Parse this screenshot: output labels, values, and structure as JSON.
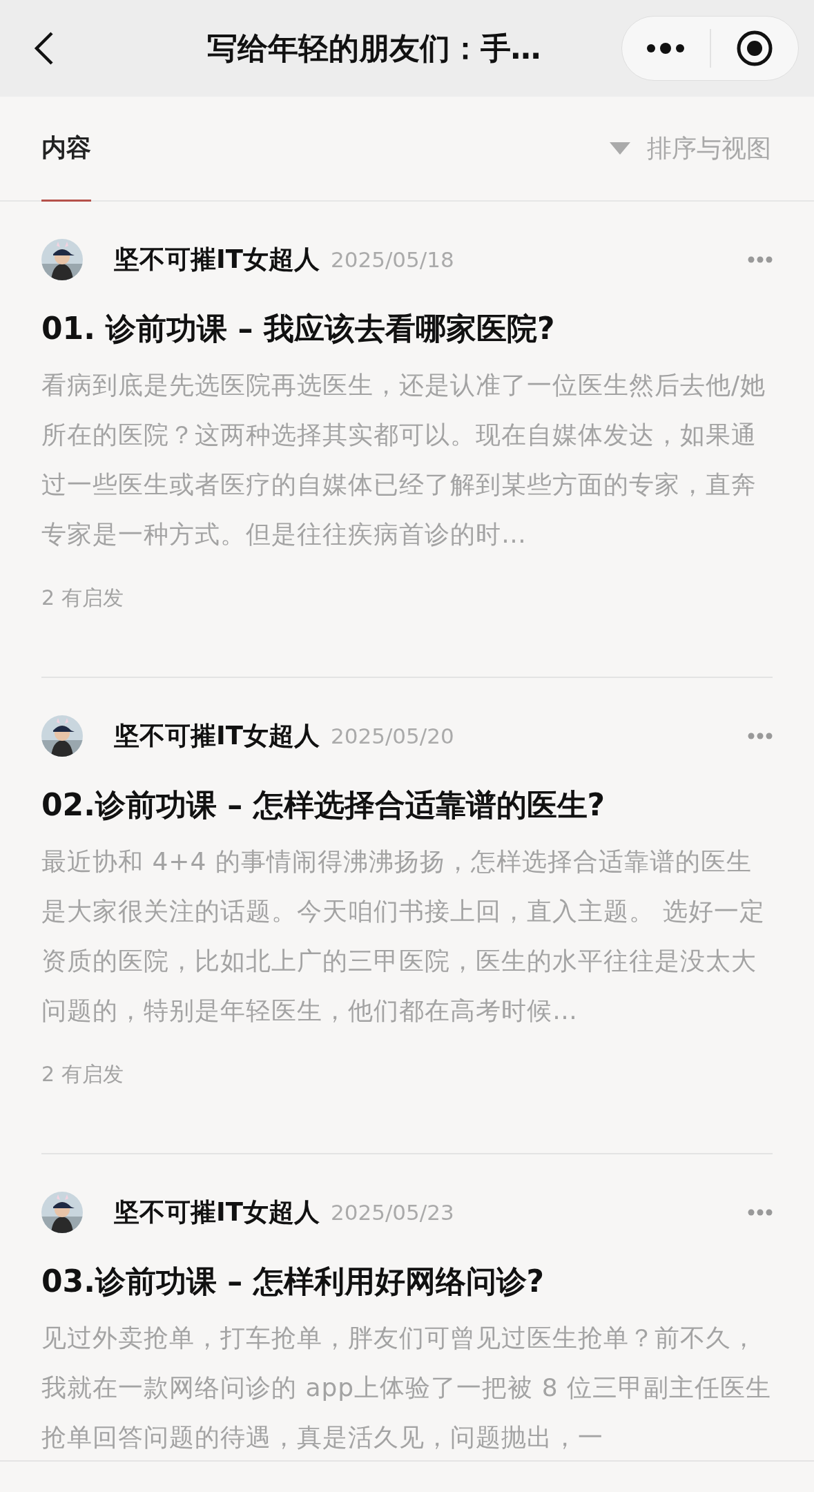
{
  "nav": {
    "title": "写给年轻的朋友们：手…"
  },
  "tabs": [
    {
      "label": "内容",
      "selected": true
    }
  ],
  "sort": {
    "label": "排序与视图"
  },
  "articles": [
    {
      "author": "坚不可摧IT女超人",
      "date": "2025/05/18",
      "title": "01. 诊前功课 – 我应该去看哪家医院?",
      "excerpt": "看病到底是先选医院再选医生，还是认准了一位医生然后去他/她所在的医院？这两种选择其实都可以。现在自媒体发达，如果通过一些医生或者医疗的自媒体已经了解到某些方面的专家，直奔专家是一种方式。但是往往疾病首诊的时…",
      "reactions": "2 有启发"
    },
    {
      "author": "坚不可摧IT女超人",
      "date": "2025/05/20",
      "title": "02.诊前功课 – 怎样选择合适靠谱的医生?",
      "excerpt": "最近协和 4+4 的事情闹得沸沸扬扬，怎样选择合适靠谱的医生是大家很关注的话题。今天咱们书接上回，直入主题。 选好一定资质的医院，比如北上广的三甲医院，医生的水平往往是没太大问题的，特别是年轻医生，他们都在高考时候…",
      "reactions": "2 有启发"
    },
    {
      "author": "坚不可摧IT女超人",
      "date": "2025/05/23",
      "title": "03.诊前功课 – 怎样利用好网络问诊?",
      "excerpt": "见过外卖抢单，打车抢单，胖友们可曾见过医生抢单？前不久，我就在一款网络问诊的 app上体验了一把被 8 位三甲副主任医生抢单回答问题的待遇，真是活久见，问题抛出，一"
    }
  ]
}
